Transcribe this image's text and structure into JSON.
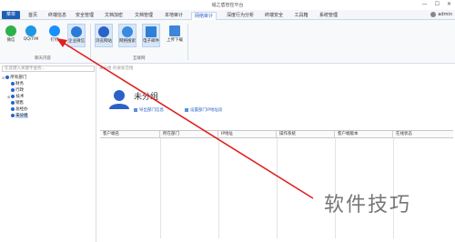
{
  "window": {
    "title": "域之盾管控平台"
  },
  "menubar": {
    "menu_button": "菜单",
    "tabs": [
      {
        "label": "首页",
        "active": false
      },
      {
        "label": "终端信息",
        "active": false
      },
      {
        "label": "安全管理",
        "active": false
      },
      {
        "label": "文档加密",
        "active": false
      },
      {
        "label": "文档管理",
        "active": false
      },
      {
        "label": "本地审计",
        "active": false
      },
      {
        "label": "网络审计",
        "active": true
      },
      {
        "label": "深度行为分析",
        "active": false
      },
      {
        "label": "终端安全",
        "active": false
      },
      {
        "label": "工具箱",
        "active": false
      },
      {
        "label": "系统管理",
        "active": false
      }
    ],
    "user": "admin"
  },
  "ribbon": {
    "chat_group": {
      "label": "聊天内容",
      "buttons": [
        {
          "label": "微信",
          "icon": "wechat-icon",
          "color": "#2fb14a",
          "highlighted": false
        },
        {
          "label": "QQ/TIM",
          "icon": "qq-icon",
          "color": "#1d98e0",
          "highlighted": false
        },
        {
          "label": "钉钉",
          "icon": "dingtalk-icon",
          "color": "#1890ff",
          "highlighted": false
        },
        {
          "label": "企业微信",
          "icon": "wecom-icon",
          "color": "#2b7ad9",
          "highlighted": true
        }
      ]
    },
    "internet_group": {
      "label": "互联网",
      "buttons": [
        {
          "label": "浏览网站",
          "icon": "browser-icon",
          "color": "#2a62c8",
          "highlighted": true
        },
        {
          "label": "网络搜索",
          "icon": "search-globe-icon",
          "color": "#3a8be0",
          "highlighted": true
        },
        {
          "label": "电子邮件",
          "icon": "email-icon",
          "color": "#2f7fd6",
          "highlighted": true
        },
        {
          "label": "上传下载",
          "icon": "upload-download-icon",
          "color": "#3e86d8",
          "highlighted": false
        }
      ]
    }
  },
  "sidebar": {
    "search_placeholder": "在此键入关键字查找...",
    "tree": [
      {
        "label": "所有部门",
        "level": 0,
        "toggle": "⊟"
      },
      {
        "label": "财务",
        "level": 1,
        "toggle": ""
      },
      {
        "label": "行政",
        "level": 1,
        "toggle": ""
      },
      {
        "label": "技术",
        "level": 1,
        "toggle": "⊞"
      },
      {
        "label": "销售",
        "level": 1,
        "toggle": ""
      },
      {
        "label": "总经办",
        "level": 1,
        "toggle": ""
      },
      {
        "label": "未分组",
        "level": 1,
        "toggle": "",
        "selected": true
      }
    ]
  },
  "main": {
    "search_placeholder": "未分组 的搜索范围",
    "group_title": "未分组",
    "links": {
      "export": "导出部门信息",
      "set_ip": "设置部门IP地址段"
    },
    "columns": [
      "客户端名",
      "所在部门",
      "IP地址",
      "操作系统",
      "客户端版本",
      "在线状态"
    ]
  },
  "watermark": "软件技巧"
}
